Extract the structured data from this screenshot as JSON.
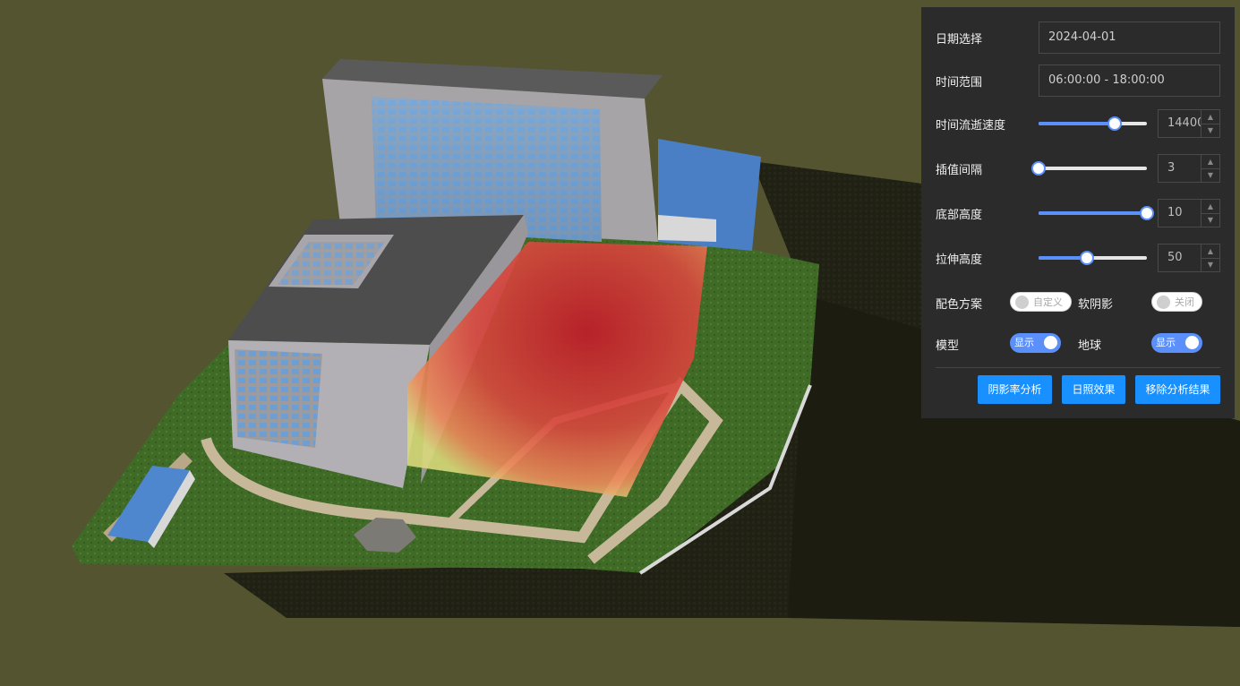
{
  "panel": {
    "date": {
      "label": "日期选择",
      "value": "2024-04-01"
    },
    "time_range": {
      "label": "时间范围",
      "value": "06:00:00 - 18:00:00"
    },
    "speed": {
      "label": "时间流逝速度",
      "value": "14400",
      "level": 0.7
    },
    "interval": {
      "label": "插值间隔",
      "value": "3",
      "level": 0.0
    },
    "base_height": {
      "label": "底部高度",
      "value": "10",
      "level": 1.0
    },
    "stretch_height": {
      "label": "拉伸高度",
      "value": "50",
      "level": 0.45
    },
    "color_scheme": {
      "label": "配色方案",
      "toggle_text": "自定义",
      "on": false
    },
    "soft_shadow": {
      "label": "软阴影",
      "toggle_text": "关闭",
      "on": false
    },
    "model": {
      "label": "模型",
      "toggle_text": "显示",
      "on": true
    },
    "globe": {
      "label": "地球",
      "toggle_text": "显示",
      "on": true
    },
    "buttons": {
      "shadow_rate": "阴影率分析",
      "sunlight": "日照效果",
      "remove": "移除分析结果"
    }
  },
  "colors": {
    "accent": "#5b8ff9",
    "button": "#1890ff",
    "panel_bg": "#2b2b2b"
  },
  "icons": {
    "spin_up": "chevron-up-icon",
    "spin_down": "chevron-down-icon"
  }
}
